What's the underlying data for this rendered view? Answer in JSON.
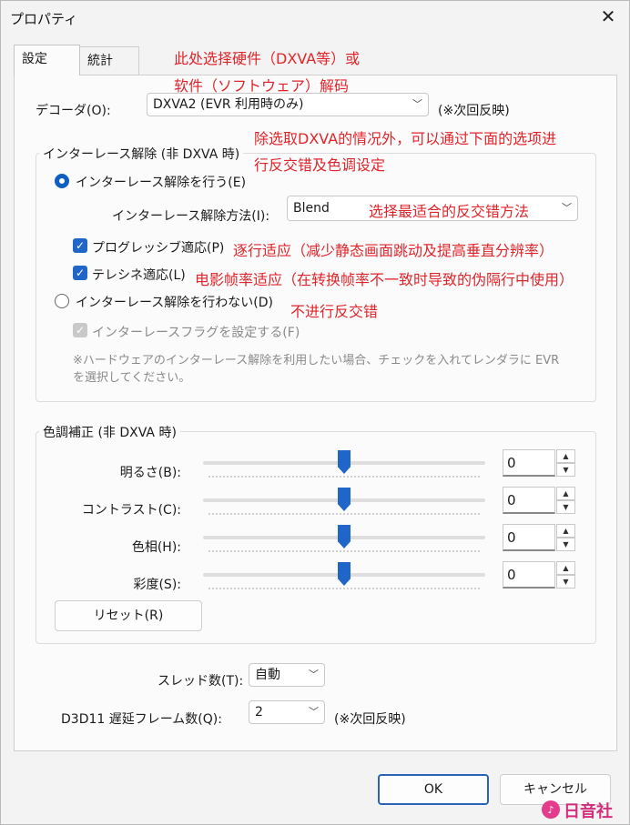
{
  "window": {
    "title": "プロパティ",
    "close_glyph": "✕"
  },
  "tabs": [
    {
      "label": "設定",
      "active": true
    },
    {
      "label": "統計",
      "active": false
    }
  ],
  "decoder": {
    "label": "デコーダ(O):",
    "value": "DXVA2 (EVR 利用時のみ)",
    "note": "(※次回反映)"
  },
  "deinterlace": {
    "title": "インターレース解除 (非 DXVA 時)",
    "enable_label": "インターレース解除を行う(E)",
    "method_label": "インターレース解除方法(I):",
    "method_value": "Blend",
    "progressive_label": "プログレッシブ適応(P)",
    "telecine_label": "テレシネ適応(L)",
    "disable_label": "インターレース解除を行わない(D)",
    "flag_label": "インターレースフラグを設定する(F)",
    "note_line1": "※ハードウェアのインターレース解除を利用したい場合、チェックを入れてレンダラに EVR",
    "note_line2": "を選択してください。"
  },
  "color": {
    "title": "色調補正 (非 DXVA 時)",
    "rows": [
      {
        "label": "明るさ(B):",
        "value": "0",
        "level": 0.5
      },
      {
        "label": "コントラスト(C):",
        "value": "0",
        "level": 0.5
      },
      {
        "label": "色相(H):",
        "value": "0",
        "level": 0.5
      },
      {
        "label": "彩度(S):",
        "value": "0",
        "level": 0.5
      }
    ],
    "reset_label": "リセット(R)"
  },
  "threads": {
    "label": "スレッド数(T):",
    "value": "自動"
  },
  "d3d11": {
    "label": "D3D11 遅延フレーム数(Q):",
    "value": "2",
    "note": "(※次回反映)"
  },
  "buttons": {
    "ok": "OK",
    "cancel": "キャンセル"
  },
  "annotations": {
    "a1_line1": "此处选择硬件（DXVA等）或",
    "a1_line2": "软件（ソフトウェア）解码",
    "a2_line1": "除选取DXVA的情况外，可以通过下面的选项进",
    "a2_line2": "行反交错及色调设定",
    "a3": "选择最适合的反交错方法",
    "a4": "逐行适应（减少静态画面跳动及提高垂直分辨率）",
    "a5": "电影帧率适应（在转换帧率不一致时导致的伪隔行中使用）",
    "a6": "不进行反交错"
  },
  "logo": {
    "text": "日音社"
  },
  "colors": {
    "accent": "#1f66c8",
    "annotation": "#e0252b"
  }
}
